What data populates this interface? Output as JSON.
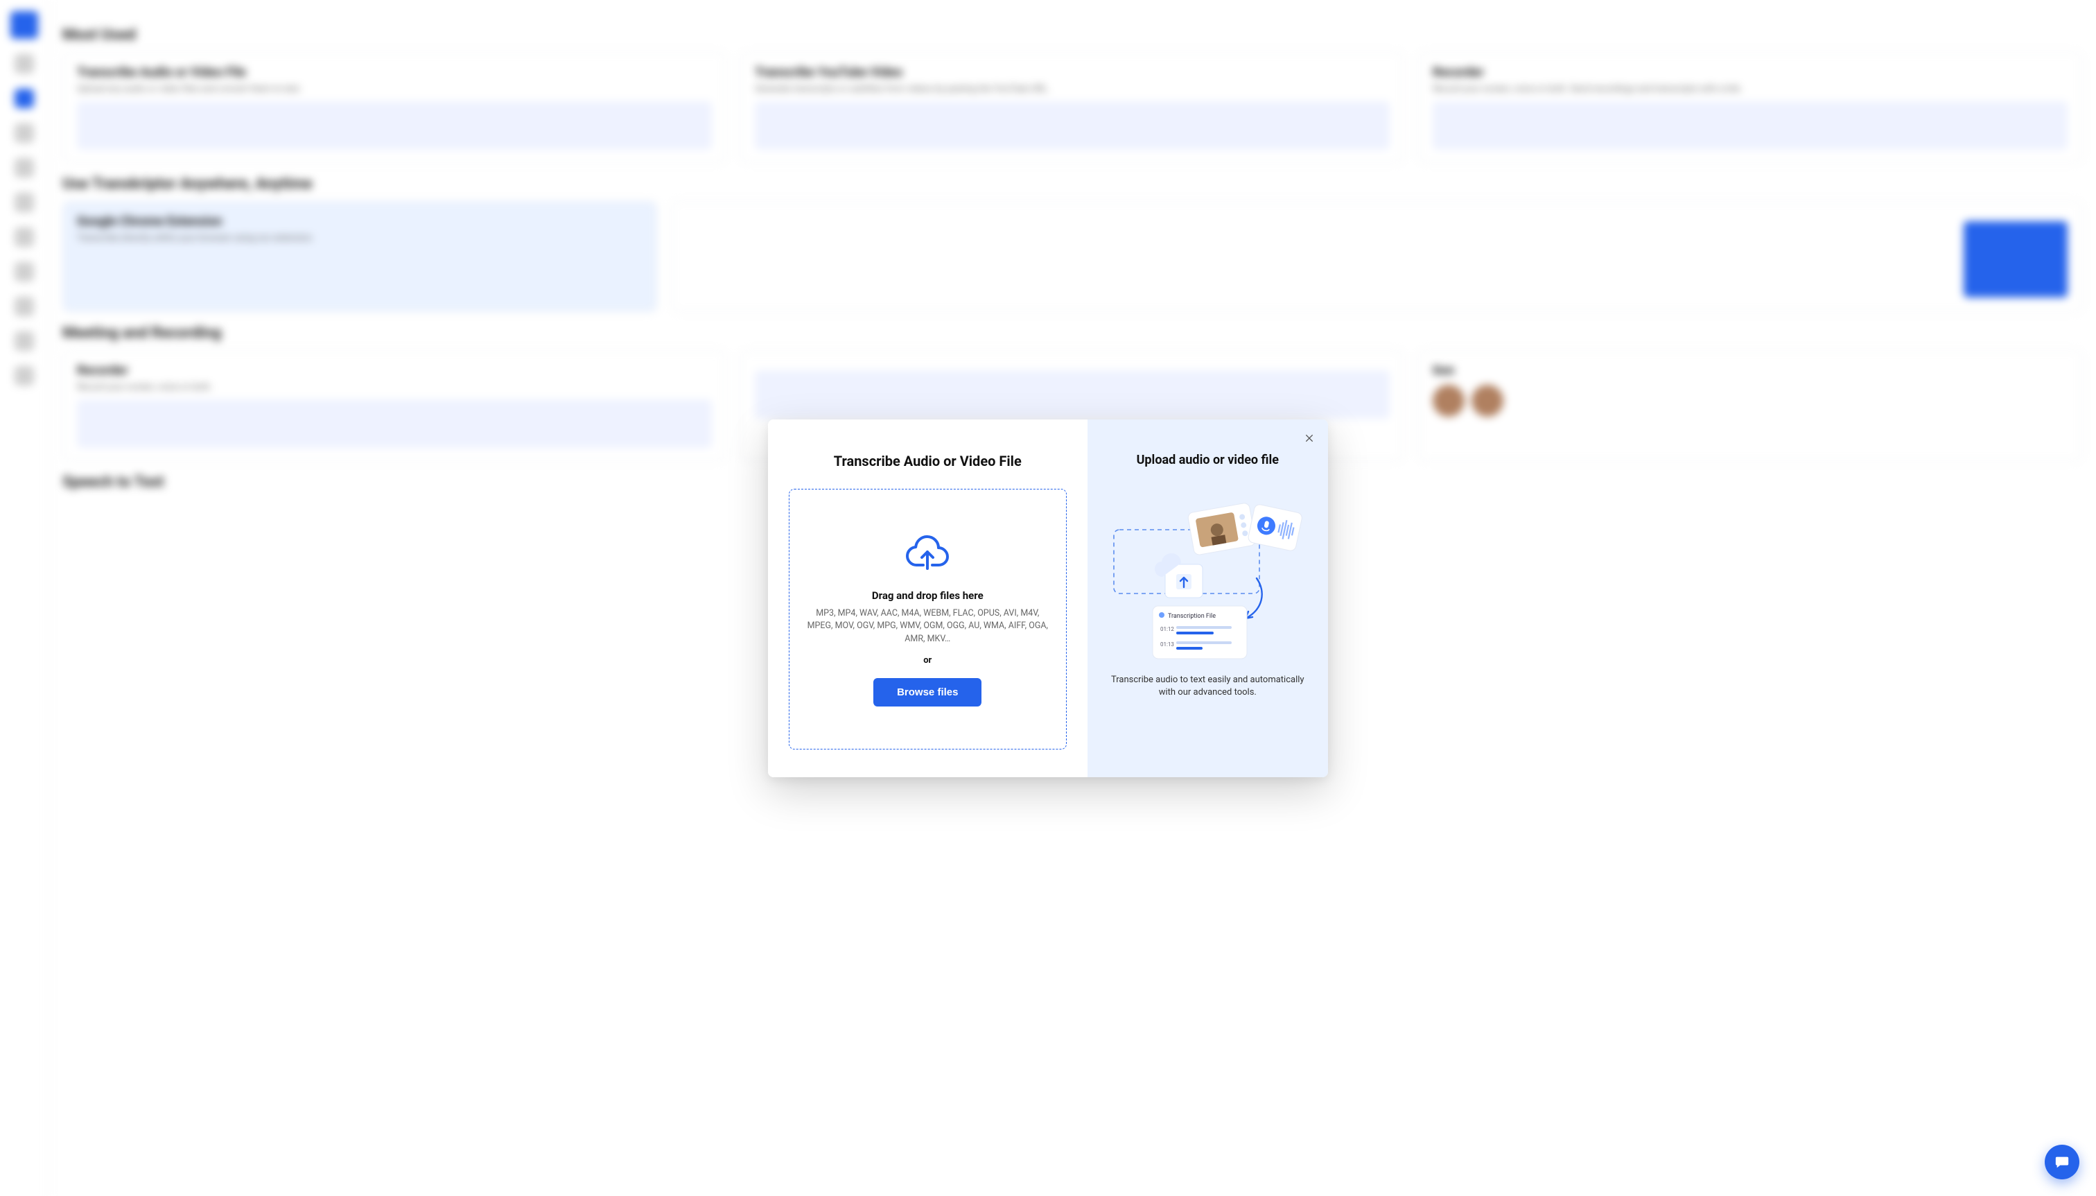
{
  "background": {
    "sections": {
      "most_used": "Most Used",
      "anywhere": "Use Transkriptor Anywhere, Anytime",
      "meeting": "Meeting and Recording",
      "speech": "Speech to Text"
    },
    "cards": {
      "c1_title": "Transcribe Audio or Video File",
      "c1_desc": "Upload any audio or video files and convert them to text.",
      "c2_title": "Transcribe YouTube Video",
      "c2_desc": "Generate transcripts or subtitles from videos by pasting the YouTube URL.",
      "c3_title": "Recorder",
      "c3_desc": "Record your screen, voice or both. Send recordings and transcripts with a link.",
      "c4_title": "Google Chrome Extension",
      "c4_desc": "Transcribe directly within your browser using our extension.",
      "c5_title": "Recorder",
      "c5_desc": "Record your screen, voice or both.",
      "c7_suffix": "tion"
    }
  },
  "modal": {
    "left_title": "Transcribe Audio or Video File",
    "drop_title": "Drag and drop files here",
    "formats": "MP3, MP4, WAV, AAC, M4A, WEBM, FLAC, OPUS, AVI, M4V, MPEG, MOV, OGV, MPG, WMV, OGM, OGG, AU, WMA, AIFF, OGA, AMR, MKV…",
    "or": "or",
    "browse": "Browse files",
    "right_title": "Upload audio or video file",
    "right_desc": "Transcribe audio to text easily and automatically with our advanced tools.",
    "illus_card_title": "Transcription File",
    "illus_t1": "01:12",
    "illus_t2": "01:13"
  }
}
